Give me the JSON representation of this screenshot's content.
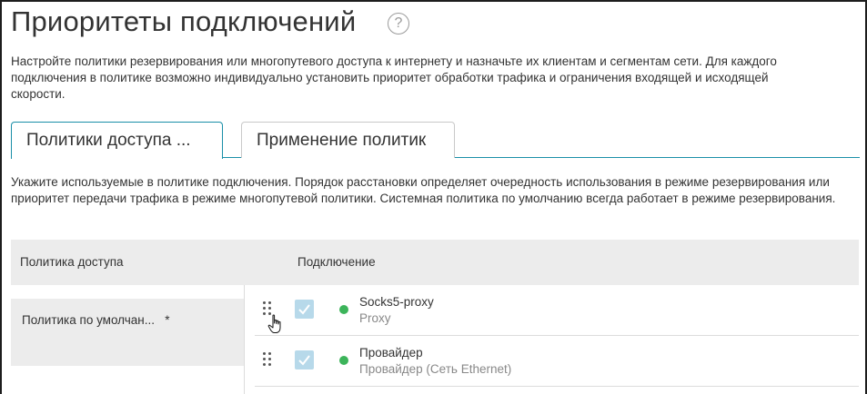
{
  "header": {
    "title": "Приоритеты подключений",
    "help_icon": "?"
  },
  "description": "Настройте политики резервирования или многопутевого доступа к интернету и назначьте их клиентам и сегментам сети. Для каждого подключения в политике возможно индивидуально установить приоритет обработки трафика и ограничения входящей и исходящей скорости.",
  "tabs": [
    {
      "label": "Политики доступа ...",
      "active": true
    },
    {
      "label": "Применение политик",
      "active": false
    }
  ],
  "info_text": "Укажите используемые в политике подключения. Порядок расстановки определяет очередность использования в режиме резервирования или приоритет передачи трафика в режиме многопутевой политики. Системная политика по умолчанию всегда работает в режиме резервирования.",
  "table": {
    "headers": [
      "Политика доступа",
      "Подключение"
    ],
    "policy": {
      "name": "Политика по умолчан...",
      "marker": "*"
    },
    "connections": [
      {
        "name": "Socks5-proxy",
        "type": "Proxy",
        "checked": true,
        "status": "online",
        "status_color": "#3cb45a"
      },
      {
        "name": "Провайдер",
        "type": "Провайдер (Сеть Ethernet)",
        "checked": true,
        "status": "online",
        "status_color": "#3cb45a"
      }
    ]
  },
  "colors": {
    "accent": "#1a8fa8",
    "checkbox": "#b7d9ea",
    "status_online": "#3cb45a",
    "header_bg": "#ececec"
  },
  "icons": {
    "help": "question-circle-icon",
    "drag": "drag-handle-icon",
    "check": "checkmark-icon",
    "cursor": "hand-pointer-icon"
  }
}
